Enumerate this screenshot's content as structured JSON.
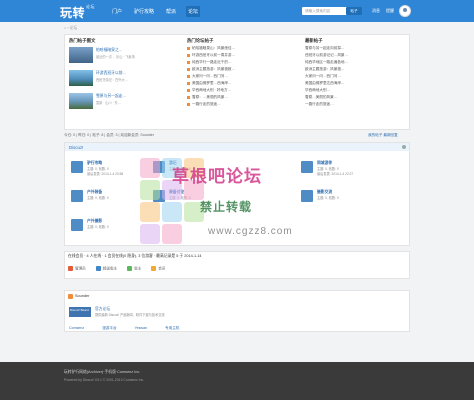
{
  "header": {
    "logo": "玩转",
    "logo_sub": "论坛",
    "nav": [
      "门户",
      "驴行攻略",
      "帮派",
      "论坛"
    ],
    "search_placeholder": "请输入搜索内容",
    "search_button": "帖子",
    "links": [
      "消息",
      "提醒"
    ]
  },
  "breadcrumb": "⌂ › 论坛",
  "hot": {
    "col1_title": "热门帖子图文",
    "col2_title": "热门论坛帖子",
    "col3_title": "最新帖子",
    "thumbs": [
      {
        "title": "帕哈福暗泉之…",
        "meta": "最近的一次… 乐山 · 飞鱼场"
      },
      {
        "title": "环游西班牙以前…",
        "meta": "西班牙游记：在外大…"
      },
      {
        "title": "雪原与另一起走…",
        "meta": "雪原 · 山川 · 东…"
      }
    ],
    "col2_items": [
      "帕哈福暗泉山：风景绝佳…",
      "环游西班牙以前一周并游…",
      "纯西华行一路走近千的…",
      "欧洲主题旅游：风景极致…",
      "大家问一问…西门河…",
      "美国由佛罗里…西海岸…",
      "华西两地大别 · 好地方…",
      "雪原：…美丽的风景…",
      "一路行走的旅途…"
    ],
    "col3_items": [
      "雪原与另一起走向前探…",
      "西班牙以前游记记…风景…",
      "纯西华地区一路走遍各地…",
      "欧洲主题旅游：风景极…",
      "大家问一问…西门河…",
      "美国由佛罗里达西海岸…",
      "华西两地大别…",
      "雪原…美丽的风景…",
      "一路行走的旅途…"
    ]
  },
  "stats": {
    "left": "今日: 0 | 昨日: 0 | 帖子: 8 | 会员: 3 | 欢迎新会员: Sounder",
    "right": "我的帖子  最新回复"
  },
  "forum": {
    "section": "Discuz!",
    "boards": [
      {
        "name": "驴行攻略",
        "meta": "主题: 0, 帖数: 0\n最后发表: 2014-1-4 20:58"
      },
      {
        "name": "游记",
        "meta": "主题: 0, 帖数: 0"
      },
      {
        "name": "同城游伴",
        "meta": "主题: 0, 帖数: 0\n最后发表: 2014-1-4 22:27"
      },
      {
        "name": "户外装备",
        "meta": "主题: 0, 帖数: 0"
      },
      {
        "name": "装备讨论",
        "meta": "主题: 0, 帖数: 0"
      },
      {
        "name": "摄影交流",
        "meta": "主题: 0, 帖数: 0"
      },
      {
        "name": "户外摄影",
        "meta": "主题: 0, 帖数: 0"
      }
    ]
  },
  "online": {
    "title": "在线会员 · 4 人在线 · 1 会员在线(0 隐身), 3 位游客 · 最高记录是 5 于 2014-1-14",
    "legend": [
      "管理员",
      "超级版主",
      "版主",
      "会员"
    ],
    "legend_colors": [
      "#e65c3b",
      "#3e86c8",
      "#5cb85c",
      "#f2a935"
    ]
  },
  "friend": {
    "title": "友情链接",
    "sounder": "Sounder",
    "img_label": "Discuz! Board",
    "name": "官方论坛",
    "desc": "提供最新 Discuz! 产品新闻、软件下载与技术交流",
    "links": [
      "Comsenz",
      "漫游平台",
      "Yeswan",
      "专用主机"
    ]
  },
  "footer": {
    "line1": "玩转驴行网络(Archiver)·手机版·Comsenz Inc.",
    "line2": "Powered by Discuz! X3.1 © 2001-2013 Comsenz Inc."
  },
  "watermark": {
    "title": "草根吧论坛",
    "subtitle": "禁止转载",
    "url": "www.cgzz8.com"
  }
}
